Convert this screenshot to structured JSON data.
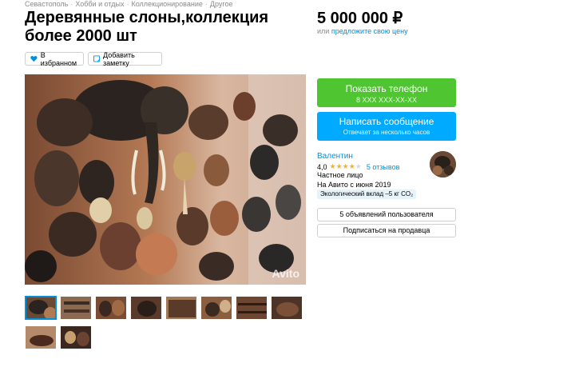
{
  "breadcrumb": [
    "Севастополь",
    "Хобби и отдых",
    "Коллекционирование",
    "Другое"
  ],
  "listing": {
    "title": "Деревянные слоны,коллекция более 2000 шт",
    "price": "5 000 000 ₽",
    "price_or": "или",
    "price_offer_link": "предложите свою цену"
  },
  "actions": {
    "favorite_label": "В избранном",
    "note_label": "Добавить заметку"
  },
  "photo": {
    "watermark": "Avito",
    "thumbnail_count": 10,
    "active_index": 0
  },
  "contact": {
    "phone_label": "Показать телефон",
    "phone_masked": "8 XXX XXX-XX-XX",
    "message_label": "Написать сообщение",
    "message_sub": "Отвечает за несколько часов"
  },
  "seller": {
    "name": "Валентин",
    "rating_value": "4,0",
    "rating_stars": 4,
    "reviews": "5 отзывов",
    "type": "Частное лицо",
    "since": "На Авито с июня 2019",
    "eco": "Экологический вклад –5 кг CO₂",
    "ads_button": "5 объявлений пользователя",
    "subscribe_button": "Подписаться на продавца"
  },
  "colors": {
    "green": "#4ec531",
    "blue": "#00aaff",
    "link": "#0091d8"
  }
}
